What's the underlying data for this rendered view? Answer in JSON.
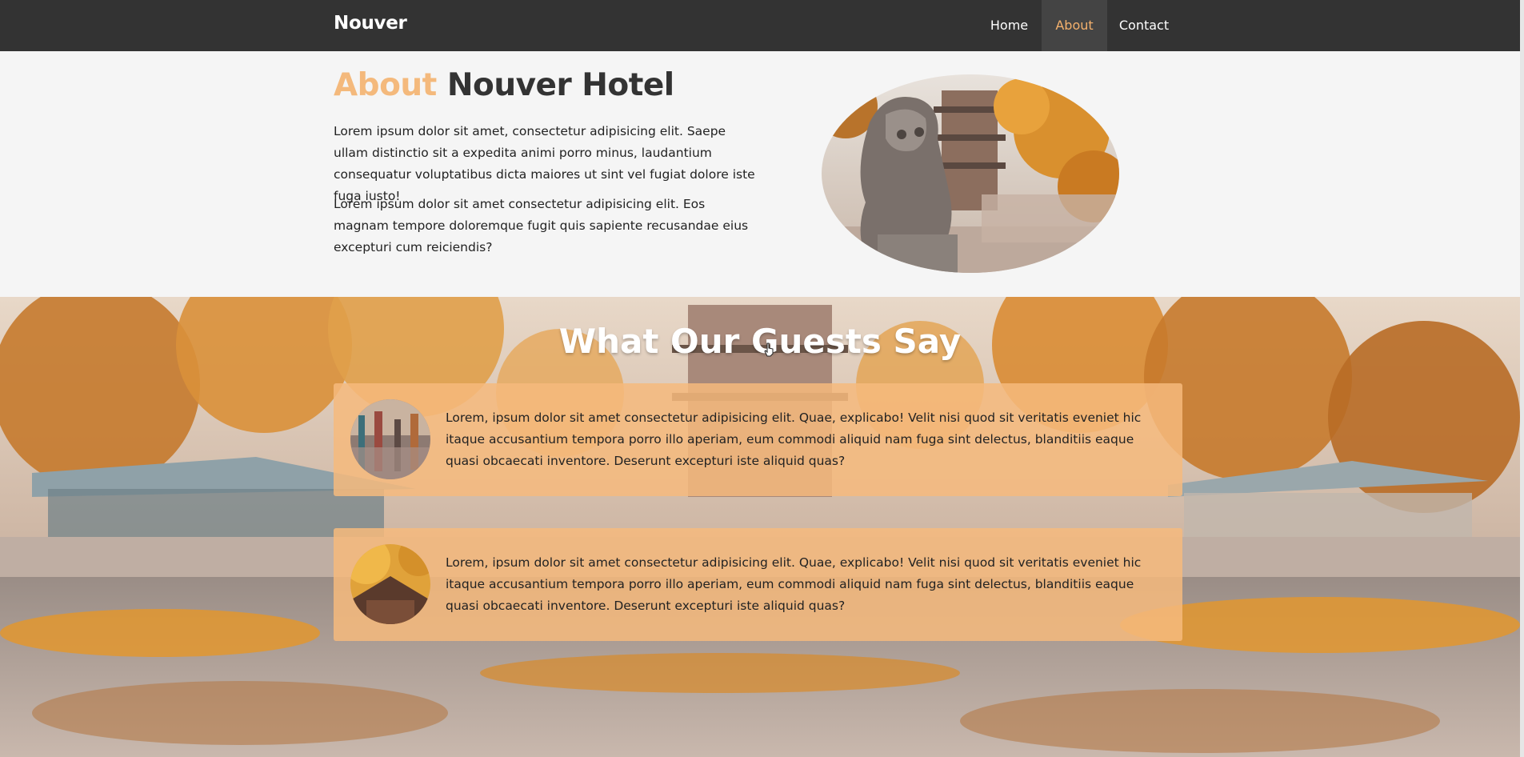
{
  "navbar": {
    "brand": "Nouver",
    "links": [
      {
        "label": "Home"
      },
      {
        "label": "About",
        "active": true
      },
      {
        "label": "Contact"
      }
    ]
  },
  "about": {
    "title_accent": "About",
    "title_rest": "Nouver Hotel",
    "paragraphs": [
      "Lorem ipsum dolor sit amet, consectetur adipisicing elit. Saepe ullam distinctio sit a expedita animi porro minus, laudantium consequatur voluptatibus dicta maiores ut sint vel fugiat dolore iste fuga iusto!",
      "Lorem ipsum dolor sit amet consectetur adipisicing elit. Eos magnam tempore doloremque fugit quis sapiente recusandae eius excepturi cum reiciendis?"
    ]
  },
  "testimonials": {
    "title": "What Our Guests Say",
    "items": [
      {
        "text": "Lorem, ipsum dolor sit amet consectetur adipisicing elit. Quae, explicabo! Velit nisi quod sit veritatis eveniet hic itaque accusantium tempora porro illo aperiam, eum commodi aliquid nam fuga sint delectus, blanditiis eaque quasi obcaecati inventore. Deserunt excepturi iste aliquid quas?"
      },
      {
        "text": "Lorem, ipsum dolor sit amet consectetur adipisicing elit. Quae, explicabo! Velit nisi quod sit veritatis eveniet hic itaque accusantium tempora porro illo aperiam, eum commodi aliquid nam fuga sint delectus, blanditiis eaque quasi obcaecati inventore. Deserunt excepturi iste aliquid quas?"
      }
    ]
  },
  "colors": {
    "navbar_bg": "#333333",
    "accent": "#f4b97c",
    "card_bg": "#f6ba7c"
  }
}
